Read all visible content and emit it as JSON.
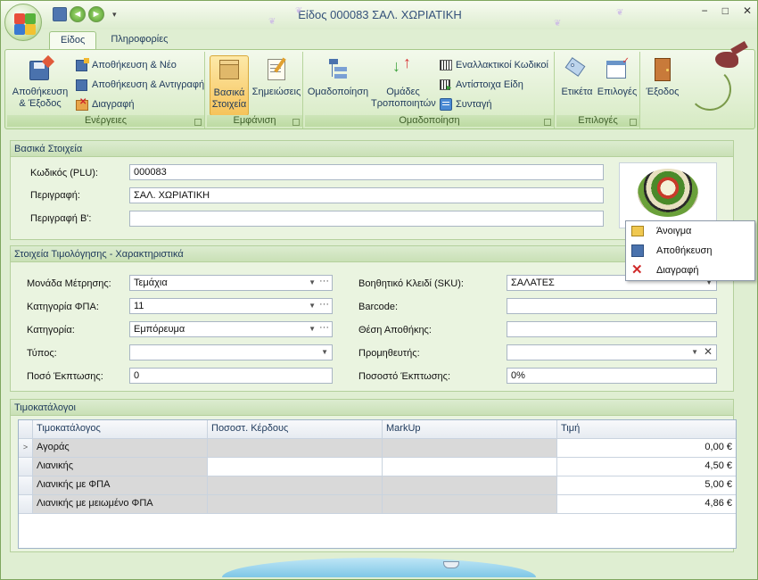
{
  "window": {
    "title": "Είδος 000083 ΣΑΛ. ΧΩΡΙΑΤΙΚΗ",
    "minimize": "−",
    "maximize": "□",
    "close": "✕"
  },
  "quick_access": {
    "save_icon": "save-icon",
    "back_icon": "back-icon",
    "forward_icon": "forward-icon",
    "dropdown": "▾"
  },
  "tabs": [
    {
      "label": "Είδος",
      "active": true
    },
    {
      "label": "Πληροφορίες",
      "active": false
    }
  ],
  "ribbon": {
    "actions_group": {
      "label": "Ενέργειες",
      "save_exit": "Αποθήκευση & Έξοδος",
      "save_new": "Αποθήκευση & Νέο",
      "save_copy": "Αποθήκευση & Αντιγραφή",
      "delete": "Διαγραφή"
    },
    "view_group": {
      "label": "Εμφάνιση",
      "basic": "Βασικά Στοιχεία",
      "notes": "Σημειώσεις"
    },
    "grouping_group": {
      "label": "Ομαδοποίηση",
      "grouping": "Ομαδοποίηση",
      "modifier_groups": "Ομάδες Τροποποιητών",
      "alt_codes": "Εναλλακτικοί Κωδικοί",
      "related_items": "Αντίστοιχα Είδη",
      "recipe": "Συνταγή"
    },
    "options_group": {
      "label": "Επιλογές",
      "label_btn": "Ετικέτα",
      "options_btn": "Επιλογές"
    },
    "exit": "Έξοδος"
  },
  "basic_info": {
    "header": "Βασικά Στοιχεία",
    "code_label": "Κωδικός (PLU):",
    "code_value": "000083",
    "desc_label": "Περιγραφή:",
    "desc_value": "ΣΑΛ. ΧΩΡΙΑΤΙΚΗ",
    "desc2_label": "Περιγραφή Β':",
    "desc2_value": ""
  },
  "context_menu": {
    "items": [
      {
        "label": "Άνοιγμα",
        "icon": "open-folder-icon"
      },
      {
        "label": "Αποθήκευση",
        "icon": "save-icon"
      },
      {
        "label": "Διαγραφή",
        "icon": "delete-icon"
      }
    ]
  },
  "pricing": {
    "header": "Στοιχεία Τιμολόγησης - Χαρακτηριστικά",
    "unit_label": "Μονάδα Μέτρησης:",
    "unit_value": "Τεμάχια",
    "vat_label": "Κατηγορία ΦΠΑ:",
    "vat_value": "11",
    "category_label": "Κατηγορία:",
    "category_value": "Εμπόρευμα",
    "type_label": "Τύπος:",
    "type_value": "",
    "discount_amount_label": "Ποσό Έκπτωσης:",
    "discount_amount_value": "0",
    "sku_label": "Βοηθητικό Κλειδί (SKU):",
    "sku_value": "ΣΑΛΑΤΕΣ",
    "barcode_label": "Barcode:",
    "barcode_value": "",
    "location_label": "Θέση Αποθήκης:",
    "location_value": "",
    "supplier_label": "Προμηθευτής:",
    "supplier_value": "",
    "discount_pct_label": "Ποσοστό Έκπτωσης:",
    "discount_pct_value": "0%"
  },
  "pricelists": {
    "header": "Τιμοκατάλογοι",
    "columns": [
      "Τιμοκατάλογος",
      "Ποσοστ. Κέρδους",
      "MarkUp",
      "Τιμή"
    ],
    "rows": [
      {
        "name": "Αγοράς",
        "profit": "",
        "markup": "",
        "price": "0,00 €"
      },
      {
        "name": "Λιανικής",
        "profit": "",
        "markup": "",
        "price": "4,50 €"
      },
      {
        "name": "Λιανικής με ΦΠΑ",
        "profit": "",
        "markup": "",
        "price": "5,00 €"
      },
      {
        "name": "Λιανικής με μειωμένο ΦΠΑ",
        "profit": "",
        "markup": "",
        "price": "4,86 €"
      }
    ]
  },
  "colors": {
    "accent": "#dfeed2",
    "panel": "#eaf4e0",
    "highlight": "#f6c35b"
  }
}
